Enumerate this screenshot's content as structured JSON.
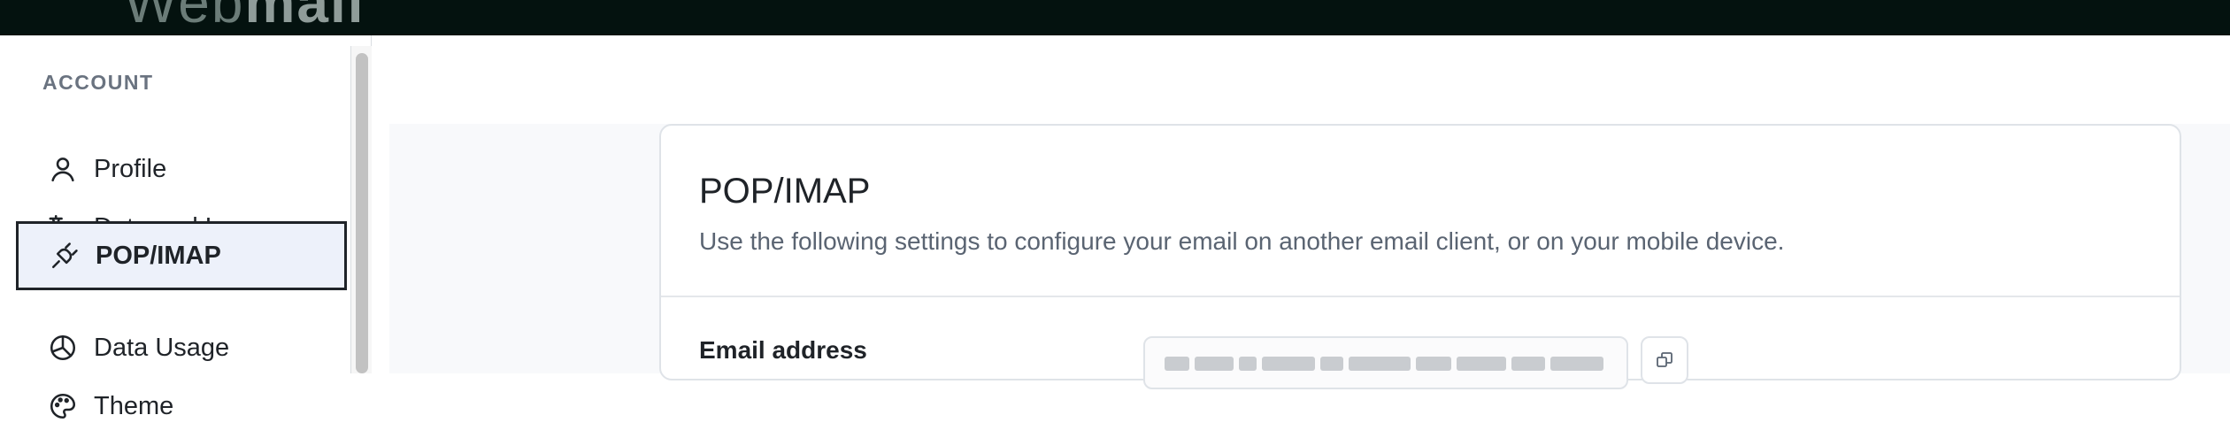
{
  "topbar": {
    "logo_light": "Web",
    "logo_bold": "mail"
  },
  "sidebar": {
    "section_label": "ACCOUNT",
    "items": [
      {
        "label": "Profile",
        "icon": "user-icon",
        "active": false
      },
      {
        "label": "Date and Langua...",
        "icon": "translate-icon",
        "active": false
      },
      {
        "label": "POP/IMAP",
        "icon": "plug-icon",
        "active": true
      },
      {
        "label": "Data Usage",
        "icon": "pie-chart-icon",
        "active": false
      },
      {
        "label": "Theme",
        "icon": "palette-icon",
        "active": false
      }
    ]
  },
  "card": {
    "title": "POP/IMAP",
    "description": "Use the following settings to configure your email on another email client, or on your mobile device.",
    "fields": [
      {
        "label": "Email address",
        "value_redacted": true,
        "copy_icon": "copy-icon"
      }
    ]
  },
  "colors": {
    "topbar_bg": "#04120f",
    "active_bg": "#edf1fa",
    "text": "#1f2328",
    "muted": "#5a6472"
  }
}
